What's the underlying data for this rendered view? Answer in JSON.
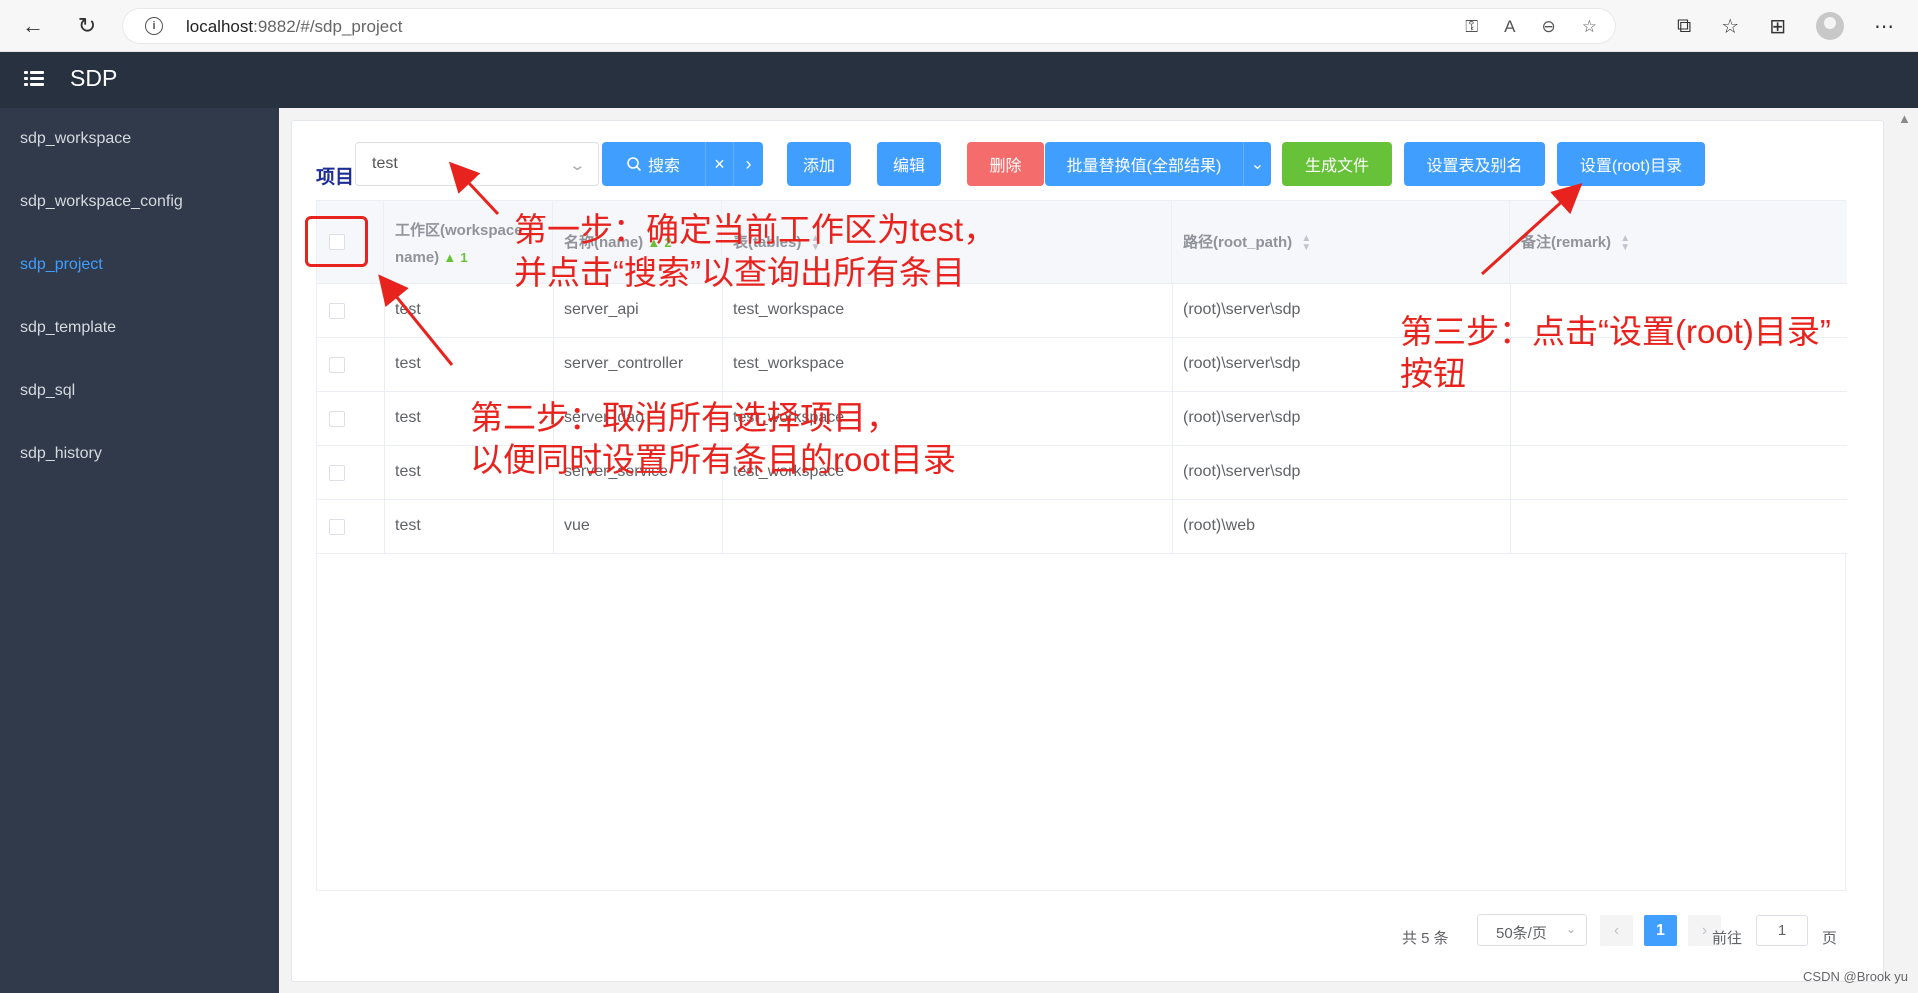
{
  "browser": {
    "url_host": "localhost",
    "url_rest": ":9882/#/sdp_project",
    "toolbar_icons": [
      "key-icon",
      "read-aloud-icon",
      "zoom-out-icon",
      "favorite-add-icon"
    ],
    "right_icons": [
      "extensions-icon",
      "favorites-icon",
      "collections-icon",
      "profile-avatar",
      "more-icon"
    ]
  },
  "app": {
    "title": "SDP"
  },
  "sidebar": {
    "items": [
      {
        "label": "sdp_workspace",
        "active": false
      },
      {
        "label": "sdp_workspace_config",
        "active": false
      },
      {
        "label": "sdp_project",
        "active": true
      },
      {
        "label": "sdp_template",
        "active": false
      },
      {
        "label": "sdp_sql",
        "active": false
      },
      {
        "label": "sdp_history",
        "active": false
      }
    ]
  },
  "toolbar": {
    "page_label": "项目",
    "workspace_select_value": "test",
    "search_label": "搜索",
    "add_label": "添加",
    "edit_label": "编辑",
    "delete_label": "删除",
    "batch_replace_label": "批量替换值(全部结果)",
    "generate_label": "生成文件",
    "set_alias_label": "设置表及别名",
    "set_root_label": "设置(root)目录"
  },
  "table": {
    "headers": {
      "workspace_line1": "工作区(workspace",
      "workspace_line2": "name)",
      "workspace_sort_order": "1",
      "name": "名称(name)",
      "name_sort_order": "2",
      "tables": "表(tables)",
      "root_path": "路径(root_path)",
      "remark": "备注(remark)"
    },
    "rows": [
      {
        "workspace": "test",
        "name": "server_api",
        "tables": "test_workspace",
        "root_path": "(root)\\server\\sdp",
        "remark": ""
      },
      {
        "workspace": "test",
        "name": "server_controller",
        "tables": "test_workspace",
        "root_path": "(root)\\server\\sdp",
        "remark": ""
      },
      {
        "workspace": "test",
        "name": "server_dao",
        "tables": "test_workspace",
        "root_path": "(root)\\server\\sdp",
        "remark": ""
      },
      {
        "workspace": "test",
        "name": "server_service",
        "tables": "test_workspace",
        "root_path": "(root)\\server\\sdp",
        "remark": ""
      },
      {
        "workspace": "test",
        "name": "vue",
        "tables": "",
        "root_path": "(root)\\web",
        "remark": ""
      }
    ]
  },
  "pagination": {
    "total": "共 5 条",
    "page_size": "50条/页",
    "current_page": "1",
    "goto_prefix": "前往",
    "goto_value": "1",
    "goto_suffix": "页"
  },
  "annotations": {
    "step1_line1": "第一步：确定当前工作区为test，",
    "step1_line2": "并点击“搜索”以查询出所有条目",
    "step2_line1": "第二步：取消所有选择项目，",
    "step2_line2": "以便同时设置所有条目的root目录",
    "step3_line1": "第三步：点击“设置(root)目录”",
    "step3_line2": "按钮",
    "color": "#e8231e"
  },
  "watermark": "CSDN @Brook yu"
}
